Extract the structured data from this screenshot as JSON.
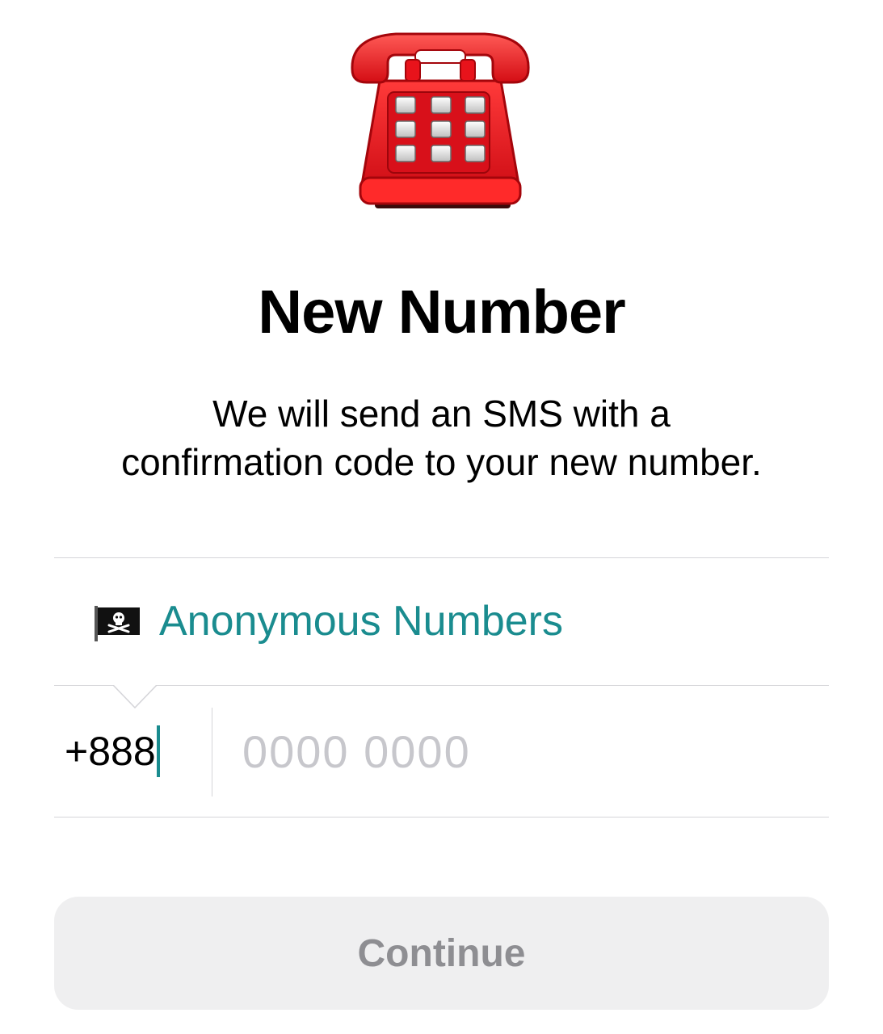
{
  "header": {
    "illustration_icon": "red-telephone-icon",
    "title": "New Number",
    "subtitle_line1": "We will send an SMS with a",
    "subtitle_line2": "confirmation code to your new number."
  },
  "country": {
    "flag_icon": "pirate-flag-icon",
    "name": "Anonymous Numbers"
  },
  "phone": {
    "country_code": "+888",
    "number_value": "",
    "number_placeholder": "0000 0000"
  },
  "actions": {
    "continue_label": "Continue"
  },
  "colors": {
    "accent": "#1a8c8f",
    "button_bg": "#efeff0",
    "button_text": "#8e8e92",
    "phone_red": "#e8131b",
    "placeholder": "#c7c7cc"
  }
}
